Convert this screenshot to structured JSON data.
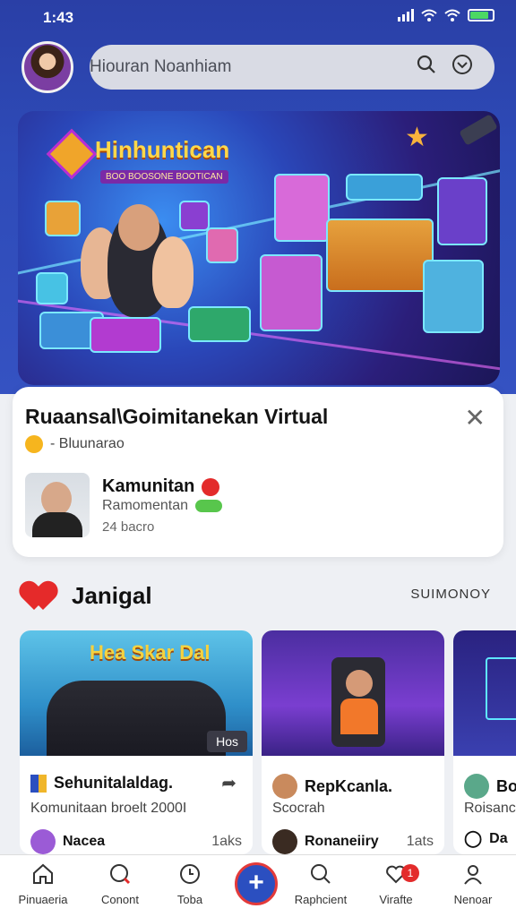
{
  "status": {
    "time": "1:43"
  },
  "search": {
    "value": "Hiouran Noanhiam"
  },
  "hero": {
    "title": "Hinhuntican",
    "subtitle": "BOO BOOSONE BOOTICAN"
  },
  "event_card": {
    "title": "Ruaansal\\Goimitanekan Virtual",
    "meta": "- Bluunarao",
    "host_name": "Kamunitan",
    "host_role": "Ramomentan",
    "host_stat": "24 bacro"
  },
  "section": {
    "title": "Janigal",
    "see_all": "SUIMONOY"
  },
  "events": [
    {
      "title": "Sehunitalaldag.",
      "subtitle": "Komunitaan broelt 2000I",
      "user": "Nacea",
      "time": "1aks",
      "host_tag": "Hos"
    },
    {
      "title": "RepKcanla.",
      "subtitle": "Scocrah",
      "user": "Ronaneiiry",
      "time": "1ats"
    },
    {
      "title": "Bo",
      "subtitle": "Roisanc",
      "user": "Da"
    }
  ],
  "nav": [
    {
      "label": "Pinuaeria",
      "icon": "home-icon"
    },
    {
      "label": "Conont",
      "icon": "chat-icon"
    },
    {
      "label": "Toba",
      "icon": "clock-icon"
    },
    {
      "label": "",
      "icon": "plus-icon"
    },
    {
      "label": "Raphcient",
      "icon": "search-icon"
    },
    {
      "label": "Virafte",
      "icon": "heart-icon",
      "badge": "1"
    },
    {
      "label": "Nenoar",
      "icon": "profile-icon"
    }
  ],
  "colors": {
    "brand": "#2b4fc0",
    "accent_red": "#e32b2b",
    "header_bg": "#2e4bb8"
  }
}
